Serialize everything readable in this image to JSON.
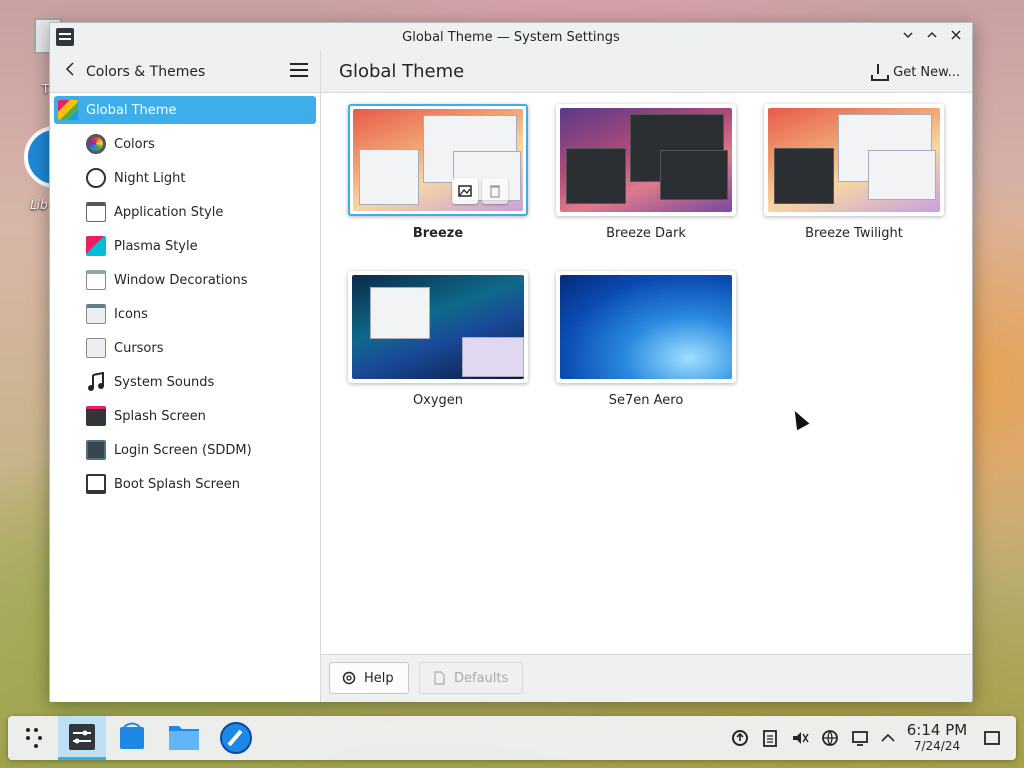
{
  "desktop": {
    "icons": [
      {
        "label": "T"
      },
      {
        "label": "Lib"
      }
    ]
  },
  "window": {
    "title": "Global Theme — System Settings"
  },
  "sidebar": {
    "section_title": "Colors & Themes",
    "items": [
      {
        "label": "Global Theme",
        "icon": "global-theme-icon",
        "active": true
      },
      {
        "label": "Colors",
        "icon": "colors-icon"
      },
      {
        "label": "Night Light",
        "icon": "night-light-icon"
      },
      {
        "label": "Application Style",
        "icon": "application-style-icon"
      },
      {
        "label": "Plasma Style",
        "icon": "plasma-style-icon"
      },
      {
        "label": "Window Decorations",
        "icon": "window-decorations-icon"
      },
      {
        "label": "Icons",
        "icon": "icons-icon"
      },
      {
        "label": "Cursors",
        "icon": "cursors-icon"
      },
      {
        "label": "System Sounds",
        "icon": "system-sounds-icon"
      },
      {
        "label": "Splash Screen",
        "icon": "splash-screen-icon"
      },
      {
        "label": "Login Screen (SDDM)",
        "icon": "login-screen-icon"
      },
      {
        "label": "Boot Splash Screen",
        "icon": "boot-splash-icon"
      }
    ]
  },
  "main": {
    "page_title": "Global Theme",
    "get_new_label": "Get New...",
    "themes": [
      {
        "name": "Breeze",
        "selected": true
      },
      {
        "name": "Breeze Dark"
      },
      {
        "name": "Breeze Twilight"
      },
      {
        "name": "Oxygen"
      },
      {
        "name": "Se7en Aero"
      }
    ]
  },
  "footer": {
    "help_label": "Help",
    "defaults_label": "Defaults"
  },
  "taskbar": {
    "time": "6:14 PM",
    "date": "7/24/24"
  },
  "colors": {
    "accent": "#3daee9",
    "window_bg": "#eff0f1"
  }
}
